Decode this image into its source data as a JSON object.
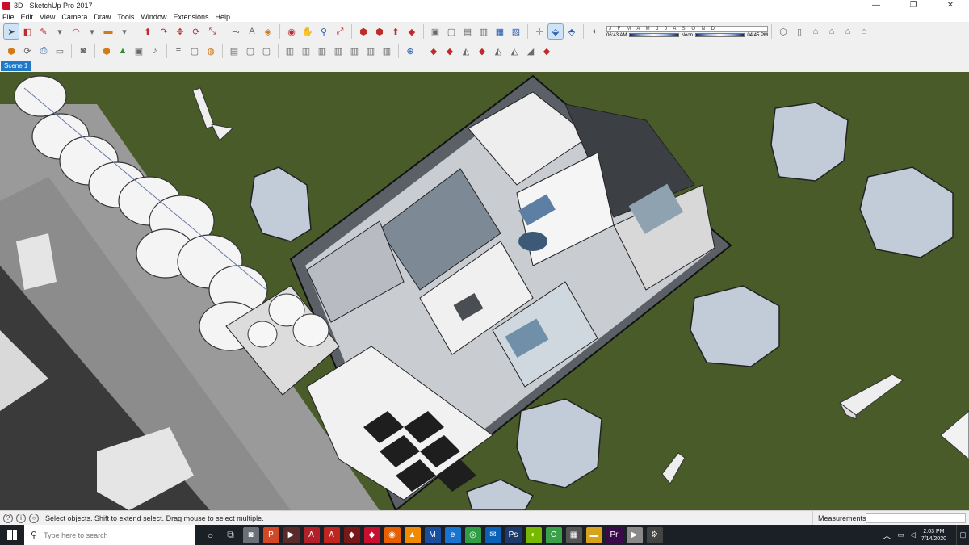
{
  "window": {
    "title": "3D - SketchUp Pro 2017",
    "controls": {
      "minimize": "—",
      "maximize": "❐",
      "close": "✕"
    }
  },
  "menu": [
    "File",
    "Edit",
    "View",
    "Camera",
    "Draw",
    "Tools",
    "Window",
    "Extensions",
    "Help"
  ],
  "shadows": {
    "months": "J F M A M J J A S O N D",
    "time_start": "06:43 AM",
    "time_noon": "Noon",
    "time_end": "04:45 PM"
  },
  "scene_tab": "Scene 1",
  "status": {
    "hint": "Select objects. Shift to extend select. Drag mouse to select multiple.",
    "measurements_label": "Measurements",
    "measurements_value": ""
  },
  "taskbar": {
    "search_placeholder": "Type here to search",
    "time": "2:03 PM",
    "date": "7/14/2020"
  },
  "colors": {
    "grass": "#4a5b2a",
    "pavement": "#9a9a9a",
    "asphalt": "#3a3a3a",
    "accent_blue": "#1f79c9"
  }
}
